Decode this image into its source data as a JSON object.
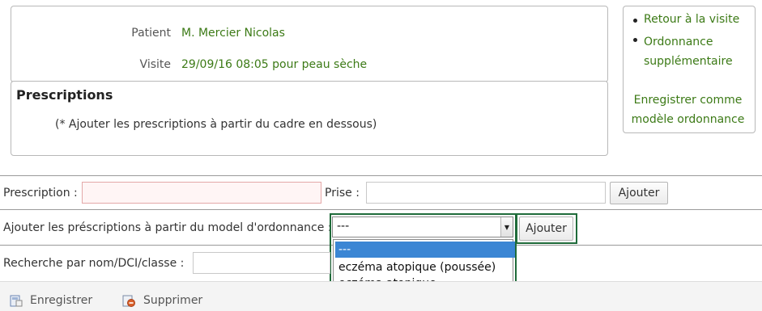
{
  "header": {
    "patient_label": "Patient",
    "patient_value": "M. Mercier Nicolas",
    "visit_label": "Visite",
    "visit_value": "29/09/16 08:05 pour peau sèche"
  },
  "prescriptions": {
    "title": "Prescriptions",
    "note": "(* Ajouter les prescriptions à partir du cadre en dessous)"
  },
  "sidebar": {
    "items": [
      {
        "label": "Retour à la visite"
      },
      {
        "label": "Ordonnance supplémentaire"
      }
    ],
    "save_template_label": "Enregistrer comme modèle ordonnance"
  },
  "form": {
    "prescription_label": "Prescription :",
    "prescription_value": "",
    "prise_label": "Prise :",
    "prise_value": "",
    "add_button_label": "Ajouter",
    "model_label": "Ajouter les préscriptions à partir du model d'ordonnance :",
    "model_selected": "---",
    "model_add_button_label": "Ajouter",
    "model_options": [
      "---",
      "eczéma atopique (poussée)",
      "eczéma atopique"
    ],
    "search_label": "Recherche par nom/DCI/classe :",
    "search_value": ""
  },
  "toolbar": {
    "save_label": "Enregistrer",
    "delete_label": "Supprimer"
  },
  "colors": {
    "link_green": "#3c7a16",
    "focus_green": "#1f6b3a",
    "highlight_blue": "#3b86d4"
  }
}
